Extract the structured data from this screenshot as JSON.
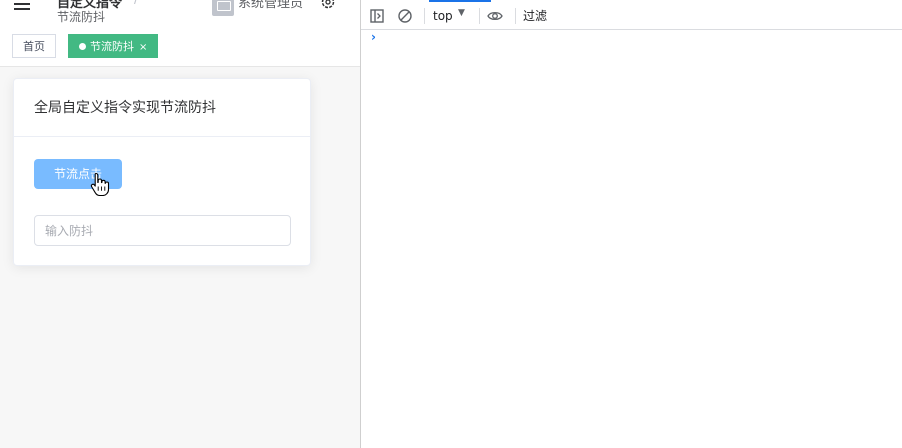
{
  "header": {
    "breadcrumb_parent": "自定义指令",
    "breadcrumb_separator": "/",
    "breadcrumb_current": "节流防抖",
    "user_name": "系统管理员"
  },
  "tags": {
    "home_label": "首页",
    "active_label": "节流防抖",
    "close_glyph": "×",
    "active_color": "#42b983"
  },
  "card": {
    "title": "全局自定义指令实现节流防抖",
    "throttle_button_label": "节流点击",
    "debounce_input_placeholder": "输入防抖",
    "debounce_input_value": "",
    "button_color": "#79bbff"
  },
  "devtools": {
    "context": "top",
    "filter_placeholder": "过滤",
    "prompt_glyph": "›",
    "icons": [
      "sidebar-toggle-icon",
      "clear-console-icon",
      "dropdown-arrow-icon",
      "eye-icon"
    ]
  }
}
